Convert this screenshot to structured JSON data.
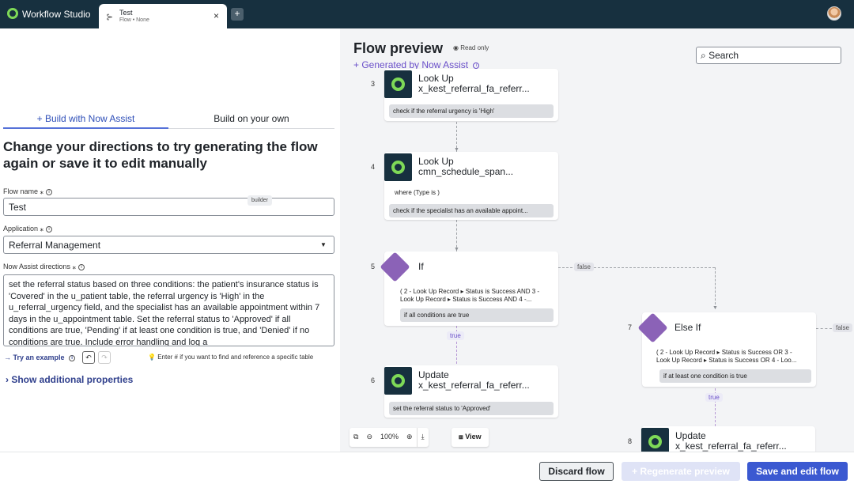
{
  "topbar": {
    "app_title": "Workflow Studio",
    "tab": {
      "title": "Test",
      "subtitle": "Flow • None",
      "close": "×"
    },
    "add_tab": "+"
  },
  "left": {
    "tabs": [
      {
        "label": "+ Build with Now Assist",
        "active": true
      },
      {
        "label": "Build on your own",
        "active": false
      }
    ],
    "heading": "Change your directions to try generating the flow again or save it to edit manually",
    "flow_name": {
      "label": "Flow name ⁎",
      "value": "Test",
      "badge": "builder"
    },
    "application": {
      "label": "Application ⁎",
      "value": "Referral Management"
    },
    "directions": {
      "label": "Now Assist directions ⁎",
      "value": "set the referral status based on three conditions: the patient's insurance status is 'Covered' in the u_patient table, the referral urgency is 'High' in the u_referral_urgency field, and the specialist has an available appointment within 7 days in the u_appointment table. Set the referral status to 'Approved' if all conditions are true, 'Pending' if at least one condition is true, and 'Denied' if no conditions are true. Include error handling and log a"
    },
    "try_example": "Try an example",
    "hint": "Enter # if you want to find and reference a specific table",
    "additional": "Show additional properties"
  },
  "preview": {
    "title": "Flow preview",
    "readonly": "Read only",
    "generated": "+ Generated by Now Assist",
    "search_placeholder": "Search",
    "steps": [
      {
        "num": "3",
        "title1": "Look Up",
        "title2": "x_kest_referral_fa_referr...",
        "annotation": "check if the referral urgency is 'High'"
      },
      {
        "num": "4",
        "title1": "Look Up",
        "title2": "cmn_schedule_span...",
        "condition": "where (Type is )",
        "annotation": "check if the specialist has an available appoint..."
      },
      {
        "num": "5",
        "title1": "If",
        "cond_line1": "( 2 - Look Up Record ▸ Status is Success  AND  3 -",
        "cond_line2": "Look Up Record ▸ Status is Success  AND  4 -...",
        "annotation": "if all conditions are true"
      },
      {
        "num": "6",
        "title1": "Update",
        "title2": "x_kest_referral_fa_referr...",
        "annotation": "set the referral status to 'Approved'"
      },
      {
        "num": "7",
        "title1": "Else If",
        "cond_line1": "( 2 - Look Up Record ▸ Status is Success  OR  3 -",
        "cond_line2": "Look Up Record ▸ Status is Success  OR  4 - Loo...",
        "annotation": "if at least one condition is true"
      },
      {
        "num": "8",
        "title1": "Update",
        "title2": "x_kest_referral_fa_referr..."
      }
    ],
    "branch_labels": {
      "false1": "false",
      "true1": "true",
      "true2": "true",
      "false2": "false"
    },
    "zoom": {
      "level": "100%",
      "view": "View"
    }
  },
  "footer": {
    "discard": "Discard flow",
    "regenerate": "+ Regenerate preview",
    "save": "Save and edit flow"
  },
  "colors": {
    "header_bg": "#17303f",
    "accent": "#3b59d1",
    "assist_purple": "#6a4fc9",
    "if_node": "#8b62b7",
    "logo_green": "#7ed957"
  }
}
